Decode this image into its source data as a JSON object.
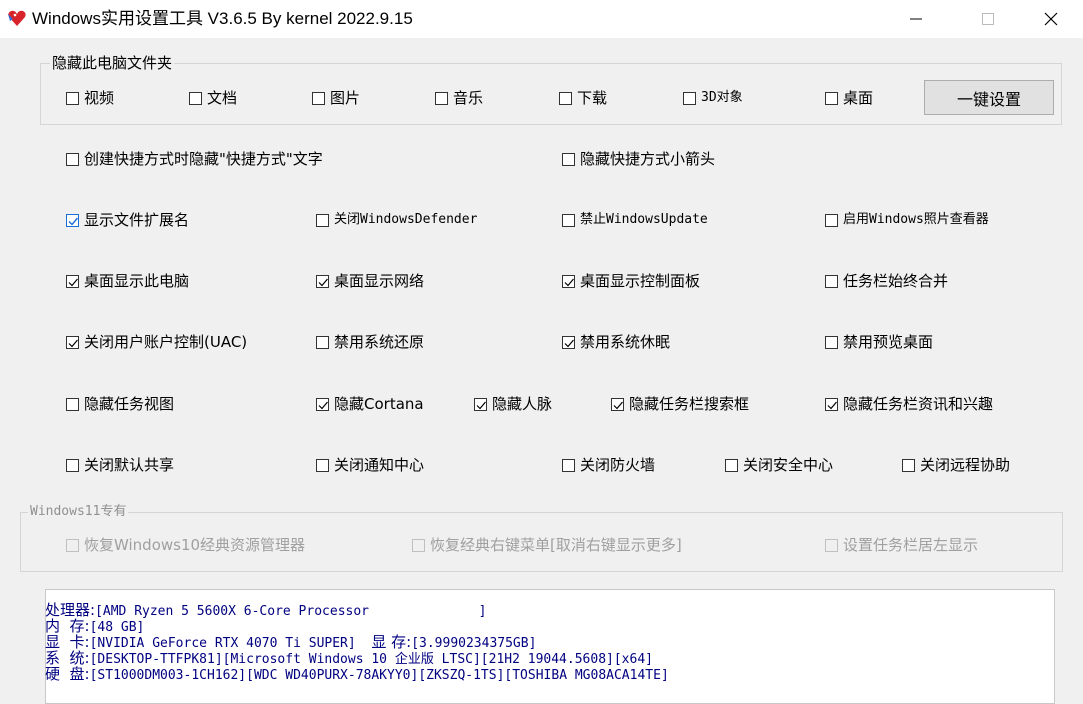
{
  "window": {
    "title": "Windows实用设置工具 V3.6.5 By kernel 2022.9.15",
    "controls": [
      "minimize",
      "maximize",
      "close"
    ]
  },
  "hide_folders": {
    "title": "隐藏此电脑文件夹",
    "items": [
      {
        "label": "视频",
        "checked": false
      },
      {
        "label": "文档",
        "checked": false
      },
      {
        "label": "图片",
        "checked": false
      },
      {
        "label": "音乐",
        "checked": false
      },
      {
        "label": "下载",
        "checked": false
      },
      {
        "label": "3D对象",
        "checked": false
      },
      {
        "label": "桌面",
        "checked": false
      }
    ],
    "button": "一键设置"
  },
  "options": {
    "shortcut_text": {
      "label": "创建快捷方式时隐藏\"快捷方式\"文字",
      "checked": false
    },
    "shortcut_arrow": {
      "label": "隐藏快捷方式小箭头",
      "checked": false
    },
    "show_ext": {
      "label": "显示文件扩展名",
      "checked": true
    },
    "close_defender": {
      "label": "关闭WindowsDefender",
      "checked": false
    },
    "disable_update": {
      "label": "禁止WindowsUpdate",
      "checked": false
    },
    "photo_viewer": {
      "label": "启用Windows照片查看器",
      "checked": false
    },
    "desk_pc": {
      "label": "桌面显示此电脑",
      "checked": true
    },
    "desk_network": {
      "label": "桌面显示网络",
      "checked": true
    },
    "desk_control": {
      "label": "桌面显示控制面板",
      "checked": true
    },
    "taskbar_merge": {
      "label": "任务栏始终合并",
      "checked": false
    },
    "close_uac": {
      "label": "关闭用户账户控制(UAC)",
      "checked": true
    },
    "disable_restore": {
      "label": "禁用系统还原",
      "checked": false
    },
    "disable_hibernate": {
      "label": "禁用系统休眠",
      "checked": true
    },
    "disable_preview": {
      "label": "禁用预览桌面",
      "checked": false
    },
    "hide_taskview": {
      "label": "隐藏任务视图",
      "checked": false
    },
    "hide_cortana": {
      "label": "隐藏Cortana",
      "checked": true
    },
    "hide_people": {
      "label": "隐藏人脉",
      "checked": true
    },
    "hide_search": {
      "label": "隐藏任务栏搜索框",
      "checked": true
    },
    "hide_news": {
      "label": "隐藏任务栏资讯和兴趣",
      "checked": true
    },
    "close_share": {
      "label": "关闭默认共享",
      "checked": false
    },
    "close_notify": {
      "label": "关闭通知中心",
      "checked": false
    },
    "close_firewall": {
      "label": "关闭防火墙",
      "checked": false
    },
    "close_security": {
      "label": "关闭安全中心",
      "checked": false
    },
    "close_remote": {
      "label": "关闭远程协助",
      "checked": false
    }
  },
  "win11": {
    "title": "Windows11专有",
    "items": [
      {
        "label": "恢复Windows10经典资源管理器",
        "checked": false
      },
      {
        "label": "恢复经典右键菜单[取消右键显示更多]",
        "checked": false
      },
      {
        "label": "设置任务栏居左显示",
        "checked": false
      }
    ]
  },
  "sysinfo": {
    "cpu_label": "处理器:",
    "cpu": "[AMD Ryzen 5 5600X 6-Core Processor              ]",
    "mem_label": "内  存:",
    "mem": "[48 GB]",
    "gpu_label": "显  卡:",
    "gpu": "[NVIDIA GeForce RTX 4070 Ti SUPER]",
    "vram_label": "显 存:",
    "vram": "[3.9990234375GB]",
    "os_label": "系  统:",
    "os": "[DESKTOP-TTFPK81][Microsoft Windows 10 企业版 LTSC][21H2 19044.5608][x64]",
    "disk_label": "硬  盘:",
    "disk": "[ST1000DM003-1CH162][WDC WD40PURX-78AKYY0][ZKSZQ-1TS][TOSHIBA MG08ACA14TE]"
  }
}
